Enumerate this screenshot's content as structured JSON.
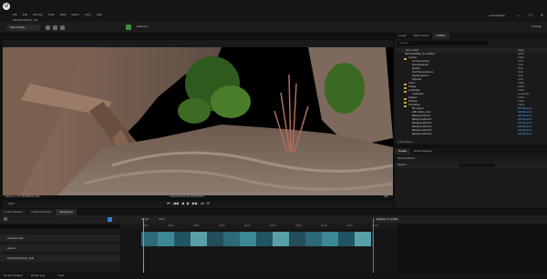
{
  "app": {
    "logo": "U",
    "title": "Unreal Editor",
    "project_tab": "MainWorld/Map_Sun"
  },
  "menu": [
    "File",
    "Edit",
    "Window",
    "Tools",
    "Build",
    "Select",
    "Actor",
    "Help"
  ],
  "window_controls": {
    "minimize": "—",
    "maximize": "☐",
    "close": "✕"
  },
  "toolbar": {
    "mode": "Select Mode",
    "platforms": "Platforms",
    "settings": "Settings"
  },
  "viewport": {
    "caption_left": "Scene 1 / 01 Shot0010_Sub",
    "caption_center": "ForestTreeTrunk (0.00) Pilot",
    "caption_right": "Clip"
  },
  "transport": {
    "time": "0009",
    "controls": [
      "⏮",
      "◀◀",
      "◀",
      "▶",
      "▶▶",
      "⏭",
      "⟳"
    ]
  },
  "bottom_tabs": [
    {
      "label": "Content Drawer",
      "active": false
    },
    {
      "label": "Content Browser",
      "active": false
    },
    {
      "label": "Sequencer",
      "active": true
    }
  ],
  "sequencer": {
    "fps": "30 fps",
    "frame": "0000",
    "ruler": [
      "0000",
      "0030",
      "0060",
      "0090",
      "0120",
      "0150",
      "0180",
      "0210",
      "0240",
      "0270"
    ],
    "tracks": [
      "Camera Cuts",
      "Actors",
      "ForestTreeTrunk_Sub"
    ],
    "right_label": "Frames: 1 / 1726",
    "status": [
      "Content Drawer",
      "Output Log",
      "Cmd"
    ]
  },
  "outliner": {
    "tabs": [
      "Levels",
      "Place Actors",
      "Outliner"
    ],
    "active_tab": "Outliner",
    "search_placeholder": "Search...",
    "columns": {
      "label": "Item Label",
      "type": "Type"
    },
    "rows": [
      {
        "label": "MainWorld/Map_Sun (Editor)",
        "type": "World",
        "indent": 0,
        "folder": false,
        "blue": false
      },
      {
        "label": "Lighting",
        "type": "Folder",
        "indent": 1,
        "folder": true,
        "blue": false
      },
      {
        "label": "AtmosphericFog",
        "type": "Actor",
        "indent": 2,
        "folder": false,
        "blue": false
      },
      {
        "label": "DirectionalLight",
        "type": "Actor",
        "indent": 2,
        "folder": false,
        "blue": false
      },
      {
        "label": "ExpFog",
        "type": "Actor",
        "indent": 2,
        "folder": false,
        "blue": false
      },
      {
        "label": "PostProcessVolume",
        "type": "Actor",
        "indent": 2,
        "folder": false,
        "blue": false
      },
      {
        "label": "SkyAtmosphere",
        "type": "Actor",
        "indent": 2,
        "folder": false,
        "blue": false
      },
      {
        "label": "SkyLight",
        "type": "Actor",
        "indent": 2,
        "folder": false,
        "blue": false
      },
      {
        "label": "Actors",
        "type": "Folder",
        "indent": 1,
        "folder": true,
        "blue": false
      },
      {
        "label": "Foliage",
        "type": "Folder",
        "indent": 1,
        "folder": true,
        "blue": false
      },
      {
        "label": "Landscape",
        "type": "Folder",
        "indent": 1,
        "folder": true,
        "blue": false
      },
      {
        "label": "Landscape",
        "type": "Landscape",
        "indent": 2,
        "folder": false,
        "blue": false
      },
      {
        "label": "Niagara",
        "type": "Folder",
        "indent": 1,
        "folder": true,
        "blue": false
      },
      {
        "label": "Particles",
        "type": "Folder",
        "indent": 1,
        "folder": true,
        "blue": false
      },
      {
        "label": "Procedural",
        "type": "Folder",
        "indent": 1,
        "folder": true,
        "blue": false
      },
      {
        "label": "BP_Alarms",
        "type": "Edit Blueprint",
        "indent": 2,
        "folder": false,
        "blue": true
      },
      {
        "label": "ABP_Minion_Fire",
        "type": "Edit Blueprint",
        "indent": 2,
        "folder": false,
        "blue": true
      },
      {
        "label": "BackgroundActor",
        "type": "Edit Blueprint",
        "indent": 2,
        "folder": false,
        "blue": true
      },
      {
        "label": "BackgroundActor2",
        "type": "Edit Blueprint",
        "indent": 2,
        "folder": false,
        "blue": true
      },
      {
        "label": "BackgroundActor3",
        "type": "Edit Blueprint",
        "indent": 2,
        "folder": false,
        "blue": true
      },
      {
        "label": "BackgroundActor4",
        "type": "Edit Blueprint",
        "indent": 2,
        "folder": false,
        "blue": true
      },
      {
        "label": "BackgroundActor5",
        "type": "Edit Blueprint",
        "indent": 2,
        "folder": false,
        "blue": true
      },
      {
        "label": "BackgroundActor6",
        "type": "Edit Blueprint",
        "indent": 2,
        "folder": false,
        "blue": true
      }
    ],
    "footer": "1,862 actors"
  },
  "details": {
    "tabs": [
      "Details",
      "World Settings"
    ],
    "active_tab": "Details",
    "subheader": "World Outliner",
    "row_label": "Search",
    "row_value": ""
  }
}
